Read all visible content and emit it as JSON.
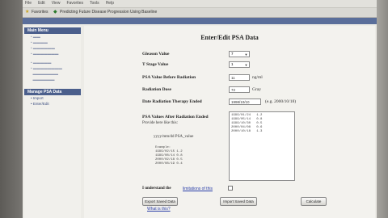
{
  "browser": {
    "menu": [
      "File",
      "Edit",
      "View",
      "Favorites",
      "Tools",
      "Help"
    ],
    "toolbar": {
      "favorites_label": "Favorites",
      "tab_label": "Predicting Future Disease Progression Using Baseline"
    }
  },
  "sidebar": {
    "section1_title": "Main Menu",
    "section2_title": "Manage PSA Data",
    "section2_items": [
      "Import",
      "Enter/Edit"
    ]
  },
  "form": {
    "title": "Enter/Edit PSA Data",
    "gleason_label": "Gleason Value",
    "gleason_value": "7",
    "tstage_label": "T Stage Value",
    "tstage_value": "1",
    "psa_before_label": "PSA Value Before Radiation",
    "psa_before_value": "11",
    "psa_before_unit": "ng/ml",
    "radiation_dose_label": "Radiation Dose",
    "radiation_dose_value": "72",
    "radiation_dose_unit": "Gray",
    "date_ended_label": "Date Radiation Therapy Ended",
    "date_ended_value": "1998/10/10",
    "date_ended_hint": "(e.g. 2000/10/18)",
    "psa_after_label": "PSA Values After Radiation Ended",
    "psa_after_hint": "Provide here like this:",
    "format_text": "yyyy/mm/dd PSA_value",
    "example_label": "Example:",
    "example_rows": [
      "1999/02/15 1.2",
      "1999/08/14 0.8",
      "2000/02/18 0.5",
      "2000/08/19 0.4"
    ],
    "psa_after_text": "1999/01/24   1.2\n1999/05/14   0.8\n1999/10/30   0.5\n2000/04/08   0.6\n2000/10/18   1.3",
    "understand_label": "I understand the",
    "limitations_link": "limitations of this",
    "export_button": "Export Saved Data",
    "whatis_link": "What is this?",
    "import_button": "Import Saved Data",
    "calculate_button": "Calculate"
  }
}
